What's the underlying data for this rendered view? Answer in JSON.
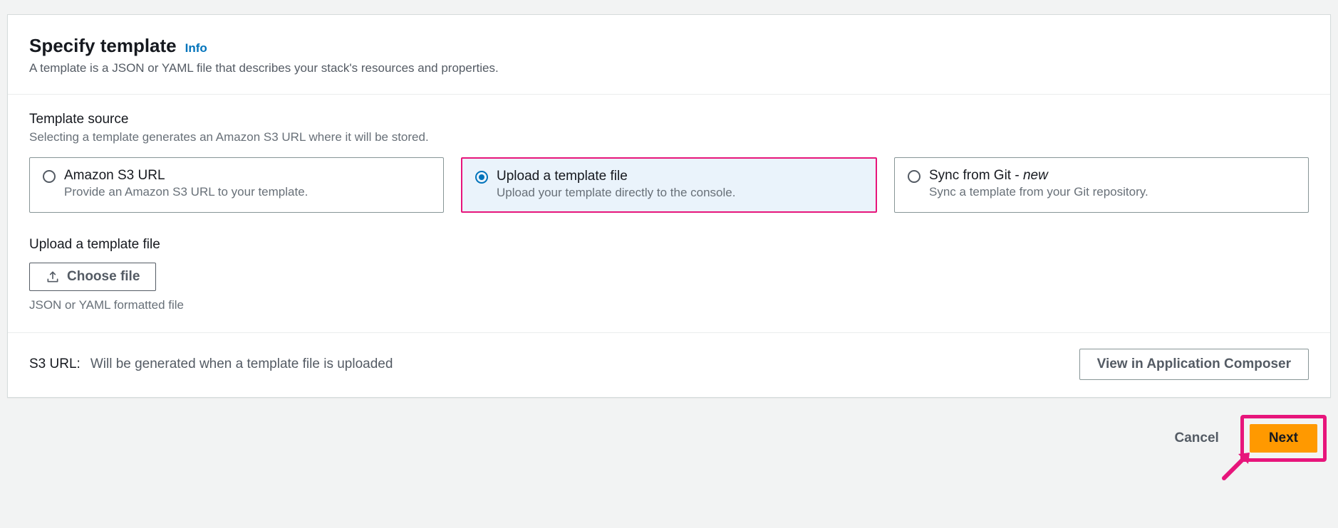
{
  "header": {
    "title": "Specify template",
    "info": "Info",
    "subtitle": "A template is a JSON or YAML file that describes your stack's resources and properties."
  },
  "source": {
    "label": "Template source",
    "desc": "Selecting a template generates an Amazon S3 URL where it will be stored.",
    "options": [
      {
        "title": "Amazon S3 URL",
        "desc": "Provide an Amazon S3 URL to your template."
      },
      {
        "title": "Upload a template file",
        "desc": "Upload your template directly to the console."
      },
      {
        "title_prefix": "Sync from Git - ",
        "title_suffix": "new",
        "desc": "Sync a template from your Git repository."
      }
    ]
  },
  "upload": {
    "label": "Upload a template file",
    "button": "Choose file",
    "hint": "JSON or YAML formatted file"
  },
  "s3": {
    "label": "S3 URL:",
    "value": "Will be generated when a template file is uploaded"
  },
  "composer_button": "View in Application Composer",
  "actions": {
    "cancel": "Cancel",
    "next": "Next"
  }
}
